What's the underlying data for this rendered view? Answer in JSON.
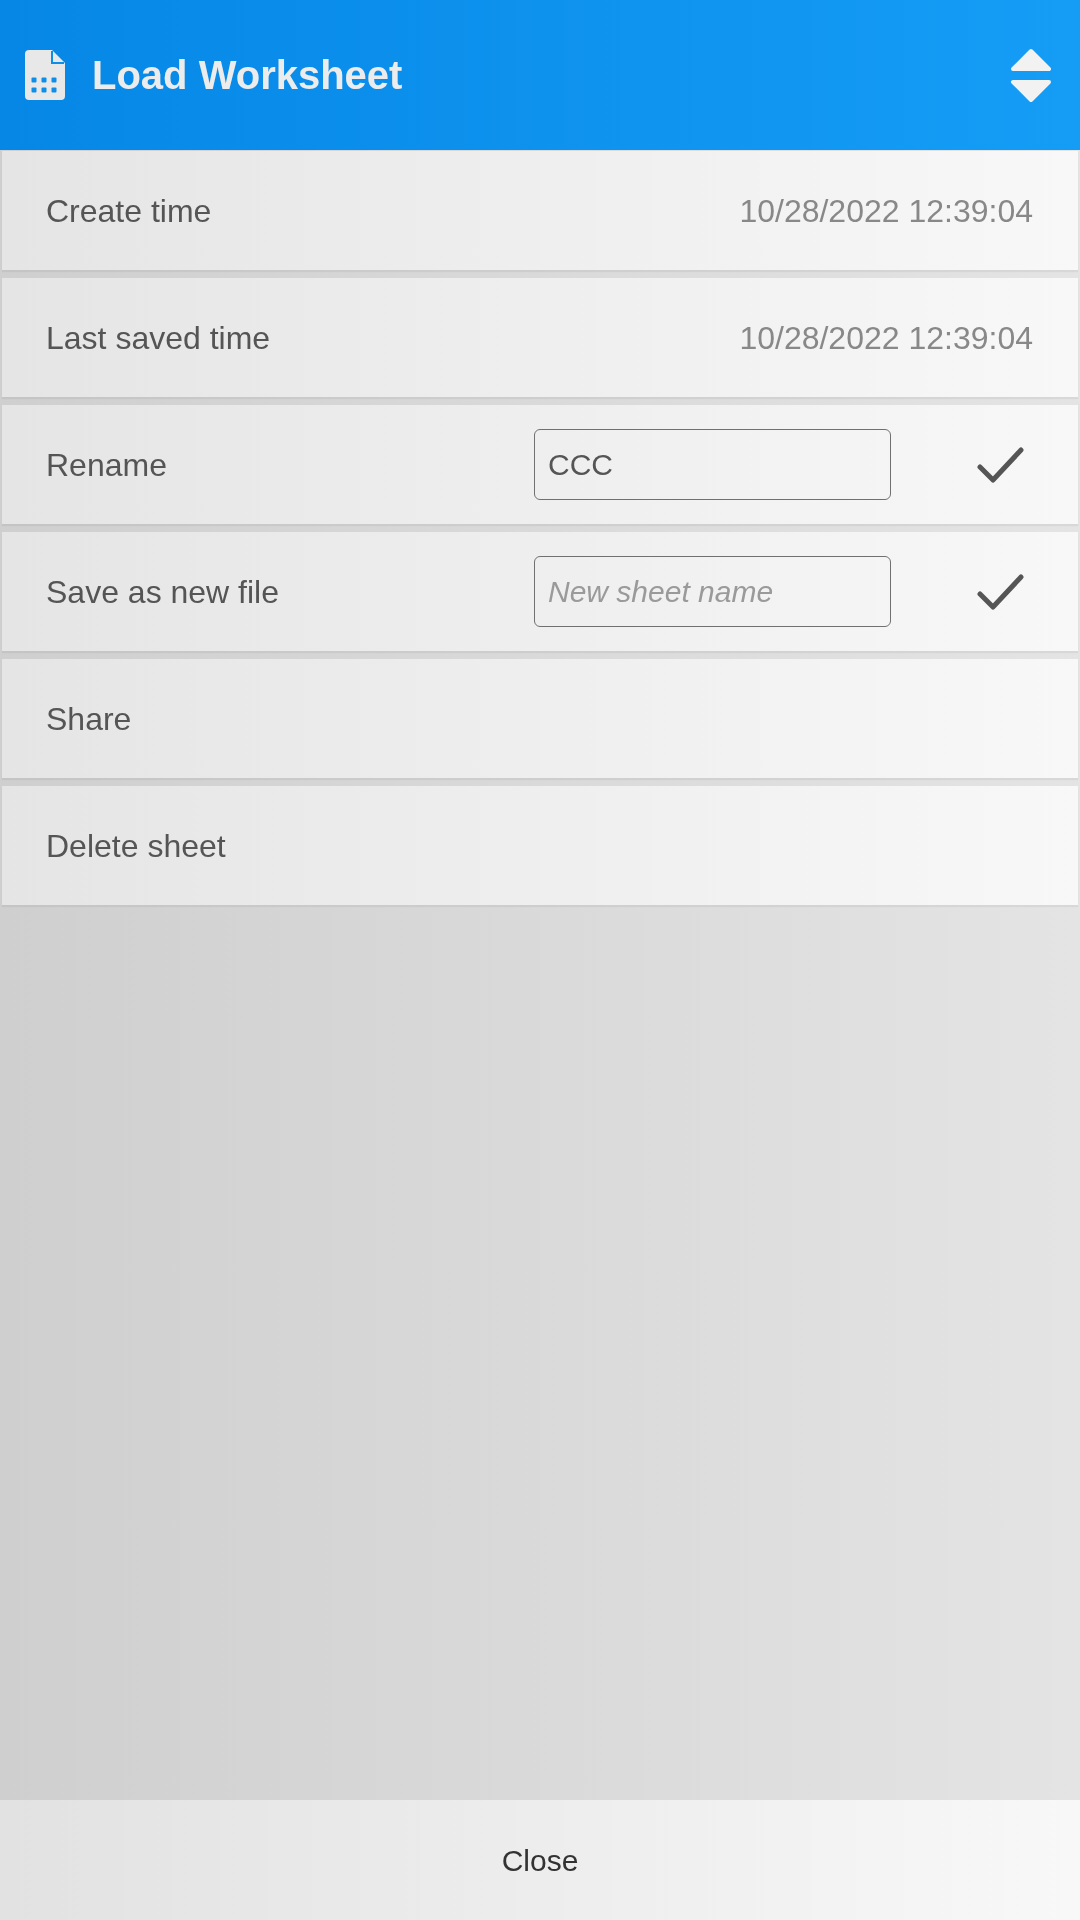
{
  "header": {
    "title": "Load Worksheet"
  },
  "rows": [
    {
      "kind": "info",
      "label": "Create time",
      "value": "10/28/2022 12:39:04"
    },
    {
      "kind": "info",
      "label": "Last saved time",
      "value": "10/28/2022 12:39:04"
    },
    {
      "kind": "input",
      "label": "Rename",
      "value": "CCC"
    },
    {
      "kind": "input",
      "label": "Save as new file",
      "placeholder": "New sheet name"
    },
    {
      "kind": "action",
      "label": "Share"
    },
    {
      "kind": "action",
      "label": "Delete sheet"
    }
  ],
  "footer": {
    "button": "Close"
  }
}
